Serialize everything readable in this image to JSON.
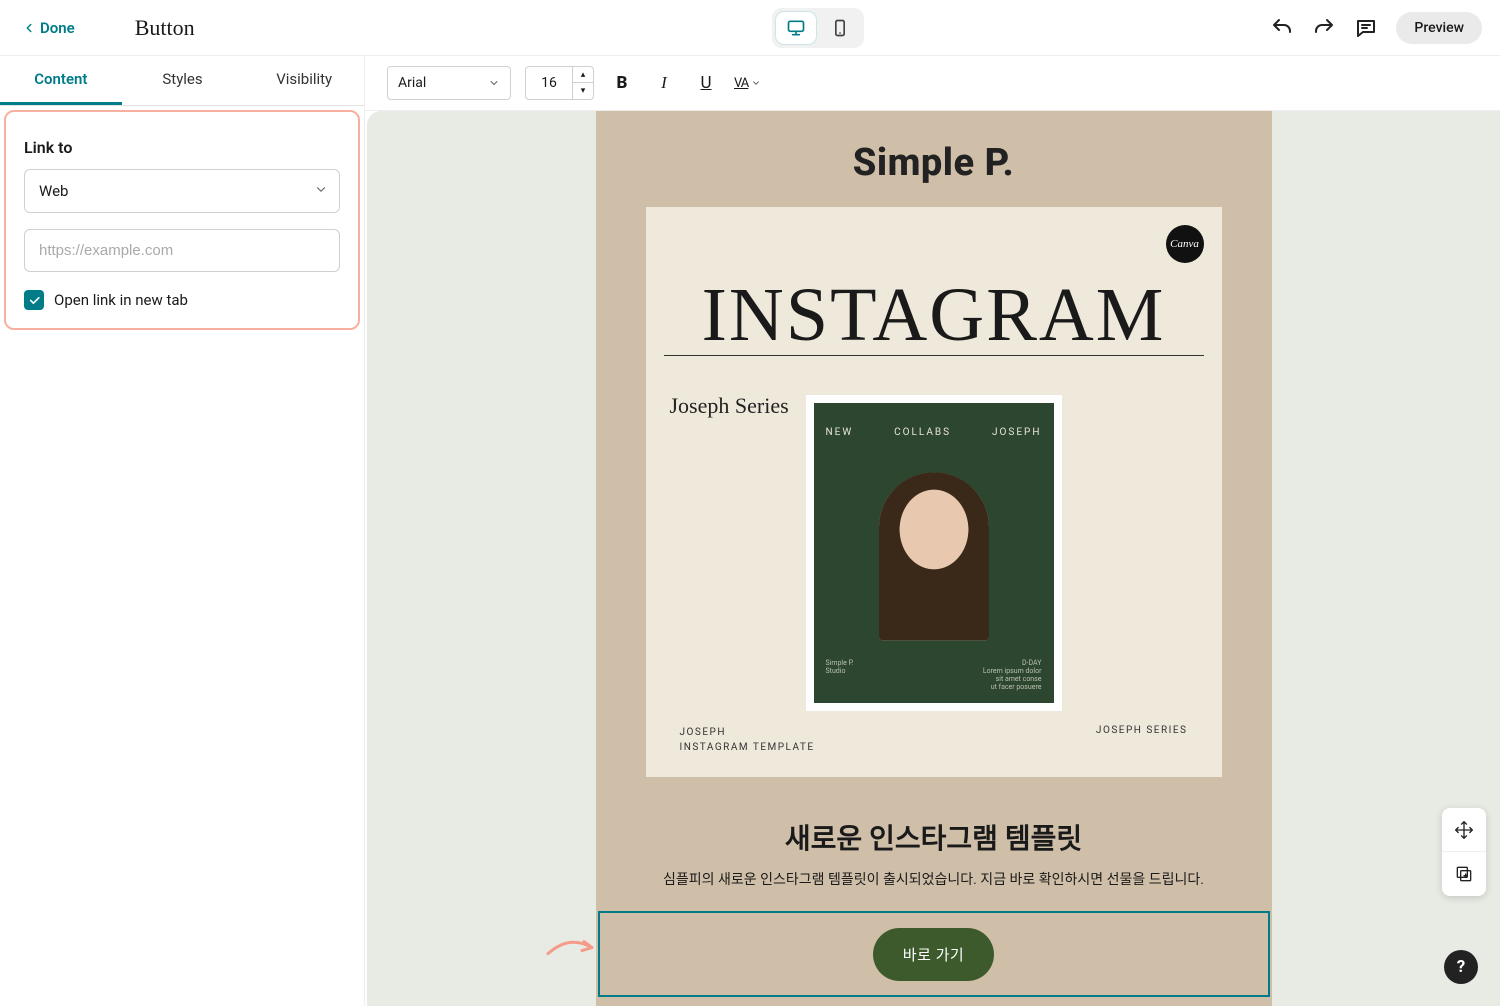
{
  "header": {
    "done_label": "Done",
    "panel_title": "Button",
    "preview_label": "Preview"
  },
  "tabs": {
    "content": "Content",
    "styles": "Styles",
    "visibility": "Visibility"
  },
  "link_panel": {
    "section_label": "Link to",
    "link_type": "Web",
    "url_placeholder": "https://example.com",
    "open_new_tab_label": "Open link in new tab",
    "open_new_tab_checked": true
  },
  "format_bar": {
    "font": "Arial",
    "size": "16",
    "bold": "B",
    "italic": "I",
    "underline": "U",
    "spacing": "VA"
  },
  "canvas": {
    "brand": "Simple P.",
    "canva_badge": "Canva",
    "ig_title": "INSTAGRAM",
    "ig_script": "Joseph Series",
    "template_top": {
      "left": "NEW",
      "center": "COLLABS",
      "right": "JOSEPH"
    },
    "template_bottom": {
      "left_a": "Simple P.",
      "left_b": "Studio",
      "right_a": "D-DAY",
      "right_b": "Lorem ipsum dolor",
      "right_c": "sit amet conse",
      "right_d": "ut facer posuere"
    },
    "footer_left_a": "JOSEPH",
    "footer_left_b": "INSTAGRAM TEMPLATE",
    "footer_right": "JOSEPH SERIES",
    "promo_title": "새로운 인스타그램 템플릿",
    "promo_desc": "심플피의 새로운 인스타그램 템플릿이 출시되었습니다. 지금 바로 확인하시면 선물을 드립니다.",
    "cta_label": "바로 가기"
  },
  "help": "?"
}
